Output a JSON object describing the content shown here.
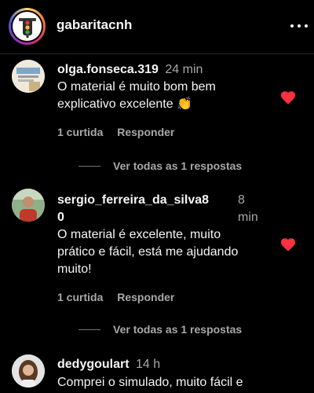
{
  "header": {
    "account_name": "gabaritacnh"
  },
  "comments": [
    {
      "username": "olga.fonseca.319",
      "time": "24 min",
      "text_line1": "O material é muito bom bem",
      "text_line2": "explicativo excelente 👏",
      "likes": "1 curtida",
      "reply_label": "Responder",
      "view_replies": "Ver todas as 1 respostas",
      "liked": true
    },
    {
      "username_line1": "sergio_ferreira_da_silva8",
      "username_line2": "0",
      "time_line1": "8",
      "time_line2": "min",
      "text_line1": "O material é excelente, muito",
      "text_line2": "prático e fácil, está me ajudando",
      "text_line3": "muito!",
      "likes": "1 curtida",
      "reply_label": "Responder",
      "view_replies": "Ver todas as 1 respostas",
      "liked": true
    },
    {
      "username": "dedygoulart",
      "time": "14 h",
      "text_line1": "Comprei o simulado, muito fácil e"
    }
  ],
  "colors": {
    "background": "#000000",
    "text": "#f5f5f5",
    "secondary": "#a8a8a8",
    "heart": "#ff3040"
  }
}
